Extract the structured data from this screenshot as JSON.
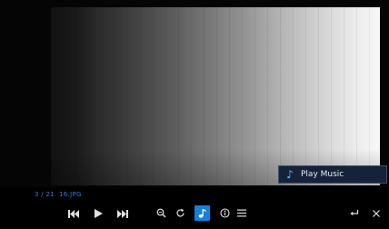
{
  "file_info": {
    "position": "3 / 21",
    "filename": "16.JPG"
  },
  "popup": {
    "label": "Play Music",
    "icon": "music-note-icon"
  },
  "controls": [
    {
      "name": "previous-button",
      "icon": "skip-previous-icon"
    },
    {
      "name": "play-button",
      "icon": "play-icon"
    },
    {
      "name": "next-button",
      "icon": "skip-next-icon"
    },
    {
      "name": "zoom-button",
      "icon": "zoom-icon"
    },
    {
      "name": "rotate-button",
      "icon": "rotate-icon"
    },
    {
      "name": "music-button",
      "icon": "music-note-icon",
      "active": true
    },
    {
      "name": "info-button",
      "icon": "info-icon"
    },
    {
      "name": "menu-button",
      "icon": "menu-icon"
    },
    {
      "name": "back-button",
      "icon": "back-arrow-icon"
    },
    {
      "name": "close-button",
      "icon": "close-icon"
    }
  ],
  "colors": {
    "accent": "#1a7fd6",
    "file_info_text": "#2a7fd9",
    "popup_bg": "#16223a",
    "icon": "#e0e0e0"
  }
}
